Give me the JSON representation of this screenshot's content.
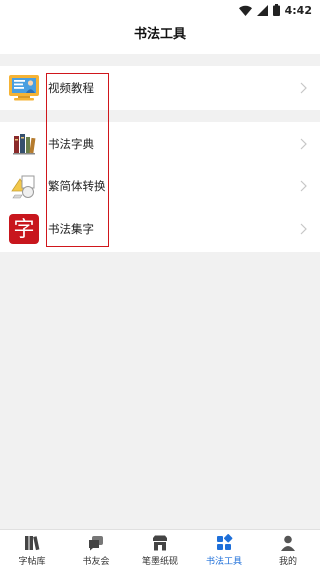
{
  "status_bar": {
    "time": "4:42"
  },
  "header": {
    "title": "书法工具"
  },
  "tools": [
    {
      "label": "视频教程",
      "icon": "video-tutorial-icon"
    },
    {
      "label": "书法字典",
      "icon": "books-icon"
    },
    {
      "label": "繁简体转换",
      "icon": "shapes-icon"
    },
    {
      "label": "书法集字",
      "icon": "zi-character-icon",
      "icon_text": "字"
    }
  ],
  "tabbar": {
    "tabs": [
      {
        "label": "字帖库",
        "icon": "books-stack-icon",
        "active": false
      },
      {
        "label": "书友会",
        "icon": "chat-bubbles-icon",
        "active": false
      },
      {
        "label": "笔墨纸砚",
        "icon": "shop-icon",
        "active": false
      },
      {
        "label": "书法工具",
        "icon": "grid-tools-icon",
        "active": true
      },
      {
        "label": "我的",
        "icon": "person-icon",
        "active": false
      }
    ]
  },
  "colors": {
    "accent": "#1e6fd9",
    "highlight": "#d0161b",
    "zi_bg": "#c8161d"
  }
}
